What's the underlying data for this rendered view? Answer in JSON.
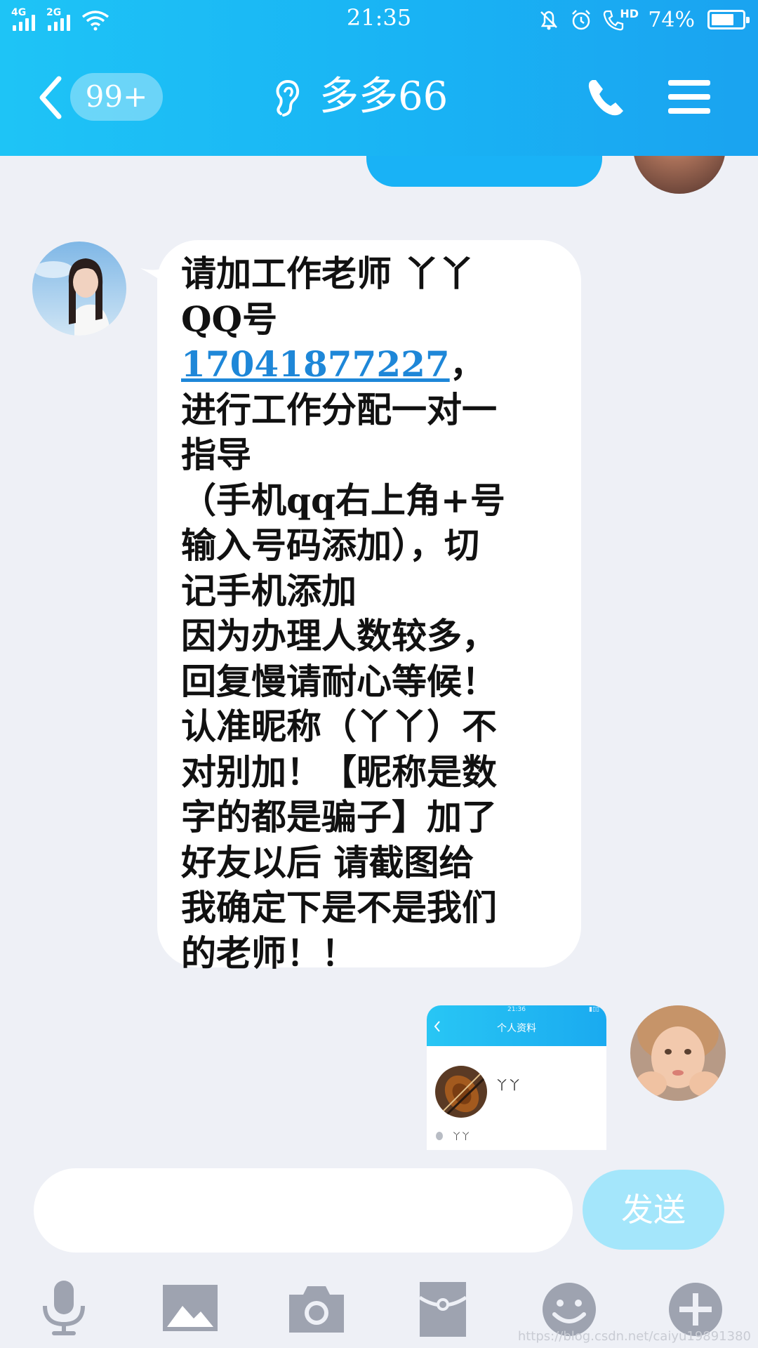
{
  "status_bar": {
    "network1": "4G",
    "network2": "2G",
    "time": "21:35",
    "hd_label": "HD",
    "battery_percent_text": "74%",
    "battery_level": 0.74
  },
  "header": {
    "unread_badge": "99+",
    "title": "多多66"
  },
  "messages": {
    "incoming": {
      "before_link": "请加工作老师 丫丫\nQQ号",
      "link": "17041877227",
      "after_link": "，\n进行工作分配一对一\n指导\n（手机qq右上角+号\n输入号码添加），切\n记手机添加\n因为办理人数较多，\n回复慢请耐心等候！\n认准昵称（丫丫）不\n对别加！【昵称是数\n字的都是骗子】加了\n好友以后 请截图给\n我确定下是不是我们\n的老师！！"
    },
    "screenshot_card": {
      "time": "21:36",
      "title": "个人资料",
      "name": "丫丫",
      "sub": "丫丫"
    }
  },
  "composer": {
    "input_value": "",
    "send_label": "发送"
  },
  "toolbar": {
    "icons": [
      "microphone-icon",
      "image-icon",
      "camera-icon",
      "red-packet-icon",
      "emoji-icon",
      "plus-icon"
    ]
  },
  "watermark": "https://blog.csdn.net/caiyu19891380",
  "colors": {
    "header_gradient_start": "#1ec4f6",
    "header_gradient_end": "#1aa3f0",
    "chat_background": "#eef0f6",
    "link": "#1e87d8",
    "send_button": "#a4e6fb",
    "toolbar_icon": "#9ea3b0"
  }
}
